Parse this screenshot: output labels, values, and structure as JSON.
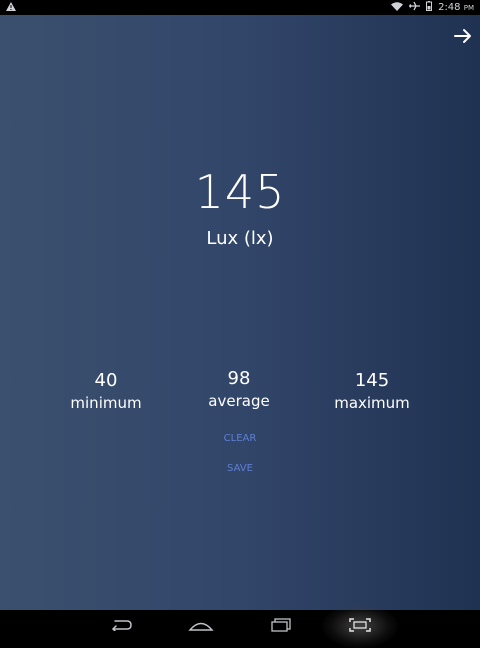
{
  "status_bar": {
    "time": "2:48",
    "ampm": "PM",
    "icons": [
      "warning-icon",
      "wifi-icon",
      "airplane-icon",
      "battery-icon"
    ]
  },
  "reading": {
    "value": "145",
    "unit": "Lux (lx)"
  },
  "stats": {
    "minimum": {
      "value": "40",
      "label": "minimum"
    },
    "average": {
      "value": "98",
      "label": "average"
    },
    "maximum": {
      "value": "145",
      "label": "maximum"
    }
  },
  "actions": {
    "clear_label": "CLEAR",
    "save_label": "SAVE"
  },
  "nav_bar": {
    "buttons": [
      "back-icon",
      "home-icon",
      "recents-icon",
      "screenshot-icon"
    ]
  },
  "colors": {
    "background_start": "#3b4f6e",
    "background_end": "#203252",
    "action_text": "#5e7fd6"
  }
}
